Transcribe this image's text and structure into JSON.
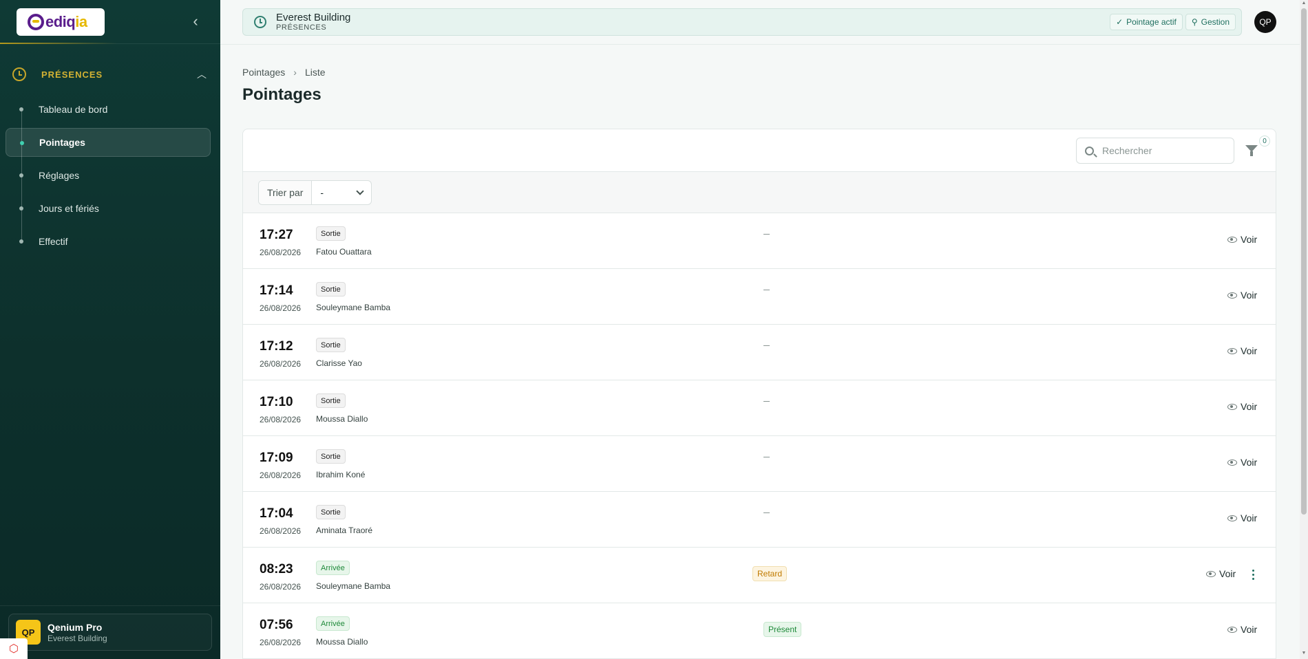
{
  "sidebar": {
    "logo": "ediqia",
    "section_title": "PRÉSENCES",
    "items": [
      {
        "label": "Tableau de bord"
      },
      {
        "label": "Pointages"
      },
      {
        "label": "Réglages"
      },
      {
        "label": "Jours et fériés"
      },
      {
        "label": "Effectif"
      }
    ],
    "user": {
      "initials": "QP",
      "name": "Qenium Pro",
      "org": "Everest Building"
    }
  },
  "topbar": {
    "title": "Everest Building",
    "subtitle": "PRÉSENCES",
    "pointage_label": "Pointage actif",
    "gestion_label": "Gestion",
    "avatar": "QP"
  },
  "breadcrumb": {
    "root": "Pointages",
    "current": "Liste"
  },
  "page_title": "Pointages",
  "search": {
    "placeholder": "Rechercher"
  },
  "filter": {
    "count": "0"
  },
  "sort": {
    "label": "Trier par",
    "value": "-"
  },
  "rows": [
    {
      "time": "17:27",
      "date": "26/08/2026",
      "type": "Sortie",
      "person": "Fatou Ouattara",
      "status": "–",
      "action": "Voir"
    },
    {
      "time": "17:14",
      "date": "26/08/2026",
      "type": "Sortie",
      "person": "Souleymane Bamba",
      "status": "–",
      "action": "Voir"
    },
    {
      "time": "17:12",
      "date": "26/08/2026",
      "type": "Sortie",
      "person": "Clarisse Yao",
      "status": "–",
      "action": "Voir"
    },
    {
      "time": "17:10",
      "date": "26/08/2026",
      "type": "Sortie",
      "person": "Moussa Diallo",
      "status": "–",
      "action": "Voir"
    },
    {
      "time": "17:09",
      "date": "26/08/2026",
      "type": "Sortie",
      "person": "Ibrahim Koné",
      "status": "–",
      "action": "Voir"
    },
    {
      "time": "17:04",
      "date": "26/08/2026",
      "type": "Sortie",
      "person": "Aminata Traoré",
      "status": "–",
      "action": "Voir"
    },
    {
      "time": "08:23",
      "date": "26/08/2026",
      "type": "Arrivée",
      "person": "Souleymane Bamba",
      "status": "Retard",
      "action": "Voir"
    },
    {
      "time": "07:56",
      "date": "26/08/2026",
      "type": "Arrivée",
      "person": "Moussa Diallo",
      "status": "Présent",
      "action": "Voir"
    }
  ],
  "colors": {
    "sidebar_bg": "#0f3a35",
    "accent_gold": "#d3b233",
    "accent_teal": "#1f6f5f"
  }
}
